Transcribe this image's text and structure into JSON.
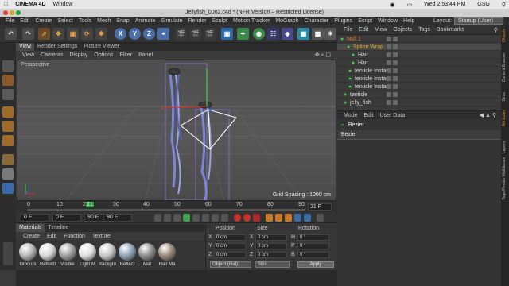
{
  "mac_menu": {
    "app": "CINEMA 4D",
    "window": "Window",
    "clock": "Wed 2:53:44 PM",
    "user": "GSG"
  },
  "title_bar": {
    "title": "Jellyfish_0002.c4d * (NFR Version – Restricted License)"
  },
  "app_menu": {
    "items": [
      "File",
      "Edit",
      "Create",
      "Select",
      "Tools",
      "Mesh",
      "Snap",
      "Animate",
      "Simulate",
      "Render",
      "Sculpt",
      "Motion Tracker",
      "MoGraph",
      "Character",
      "Plugins",
      "Script",
      "Window",
      "Help"
    ],
    "layout_label": "Layout:",
    "layout_value": "Startup (User)"
  },
  "toolbar": {
    "axis_x": "X",
    "axis_y": "Y",
    "axis_z": "Z"
  },
  "viewport": {
    "tabs": [
      "View",
      "Render Settings",
      "Picture Viewer"
    ],
    "menu": [
      "View",
      "Cameras",
      "Display",
      "Options",
      "Filter",
      "Panel"
    ],
    "camera_label": "Perspective",
    "grid_spacing": "Grid Spacing : 1000 cm"
  },
  "timeline": {
    "ticks": [
      "0",
      "10",
      "20",
      "30",
      "40",
      "50",
      "60",
      "70",
      "80",
      "90"
    ],
    "current_frame_marker": "21",
    "end_frame_display": "21 F"
  },
  "transport": {
    "start": "0 F",
    "current": "0 F",
    "preview_end": "90 F",
    "end": "90 F"
  },
  "materials": {
    "tabs": [
      "Materials",
      "Timeline"
    ],
    "menu": [
      "Create",
      "Edit",
      "Function",
      "Texture"
    ],
    "items": [
      {
        "label": "Glbours",
        "color": "#b8b8b8"
      },
      {
        "label": "Reflecti",
        "color": "#d8d8d8"
      },
      {
        "label": "Visible",
        "color": "#a0a0a0"
      },
      {
        "label": "Light M",
        "color": "#e0e0e0"
      },
      {
        "label": "Backgro",
        "color": "#c8c8c8"
      },
      {
        "label": "Reflect",
        "color": "#8fa4b8"
      },
      {
        "label": "Mat",
        "color": "#8e8e8e"
      },
      {
        "label": "Hair Ma",
        "color": "#9a8a7a"
      }
    ]
  },
  "coordinates": {
    "headers": {
      "position": "Position",
      "size": "Size",
      "rotation": "Rotation"
    },
    "rows": [
      {
        "axis": "X",
        "pos": "0 cm",
        "size_axis": "X",
        "size": "0 cm",
        "rot_axis": "H",
        "rot": "0 °"
      },
      {
        "axis": "Y",
        "pos": "0 cm",
        "size_axis": "Y",
        "size": "0 cm",
        "rot_axis": "P",
        "rot": "0 °"
      },
      {
        "axis": "Z",
        "pos": "0 cm",
        "size_axis": "Z",
        "size": "0 cm",
        "rot_axis": "B",
        "rot": "0 °"
      }
    ],
    "mode": "Object (Rel)",
    "size_mode": "Size",
    "apply": "Apply"
  },
  "object_manager": {
    "menu": [
      "File",
      "Edit",
      "View",
      "Objects",
      "Tags",
      "Bookmarks"
    ],
    "objects": [
      {
        "name": "Null.1",
        "color": "#e07a2a"
      },
      {
        "name": "Spline Wrap",
        "color": "#e0a82a"
      },
      {
        "name": "Hair",
        "color": "#dcdcdc"
      },
      {
        "name": "Hair",
        "color": "#dcdcdc"
      },
      {
        "name": "tenticle Instan",
        "color": "#dcdcdc"
      },
      {
        "name": "tenticle Instan",
        "color": "#dcdcdc"
      },
      {
        "name": "tenticle Instan",
        "color": "#dcdcdc"
      },
      {
        "name": "tenticle",
        "color": "#dcdcdc"
      },
      {
        "name": "jelly_fish",
        "color": "#dcdcdc"
      }
    ]
  },
  "attribute_manager": {
    "menu": [
      "Mode",
      "Edit",
      "User Data"
    ],
    "object_title": "Bezier",
    "field_value": "Bezier"
  },
  "right_tabs": [
    "Objects",
    "Content Browser",
    "Struc",
    "Attributes",
    "Layers",
    "Tags Render Multiboxes"
  ],
  "colors": {
    "accent_orange": "#e08a2a",
    "axis_blue": "#4a6ea8",
    "play_green": "#3fa34d",
    "record_red": "#c8322a"
  }
}
